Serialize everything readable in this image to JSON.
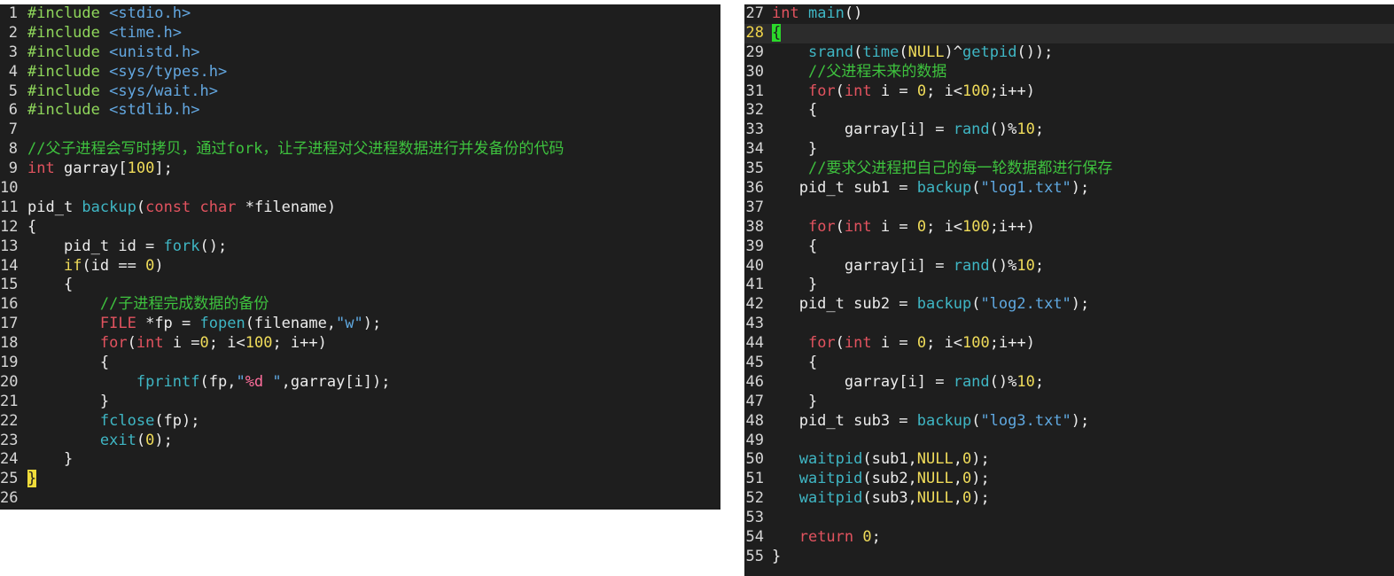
{
  "left_pane": {
    "lines": [
      {
        "n": "1",
        "tokens": [
          [
            "pre",
            "#include "
          ],
          [
            "inc",
            "<stdio.h>"
          ]
        ]
      },
      {
        "n": "2",
        "tokens": [
          [
            "pre",
            "#include "
          ],
          [
            "inc",
            "<time.h>"
          ]
        ]
      },
      {
        "n": "3",
        "tokens": [
          [
            "pre",
            "#include "
          ],
          [
            "inc",
            "<unistd.h>"
          ]
        ]
      },
      {
        "n": "4",
        "tokens": [
          [
            "pre",
            "#include "
          ],
          [
            "inc",
            "<sys/types.h>"
          ]
        ]
      },
      {
        "n": "5",
        "tokens": [
          [
            "pre",
            "#include "
          ],
          [
            "inc",
            "<sys/wait.h>"
          ]
        ]
      },
      {
        "n": "6",
        "tokens": [
          [
            "pre",
            "#include "
          ],
          [
            "inc",
            "<stdlib.h>"
          ]
        ]
      },
      {
        "n": "7",
        "tokens": []
      },
      {
        "n": "8",
        "tokens": [
          [
            "cmt",
            "//父子进程会写时拷贝，通过fork，让子进程对父进程数据进行并发备份的代码"
          ]
        ]
      },
      {
        "n": "9",
        "tokens": [
          [
            "kw",
            "int"
          ],
          [
            "txt",
            " garray["
          ],
          [
            "num",
            "100"
          ],
          [
            "txt",
            "];"
          ]
        ]
      },
      {
        "n": "10",
        "tokens": []
      },
      {
        "n": "11",
        "tokens": [
          [
            "txt",
            "pid_t "
          ],
          [
            "fn",
            "backup"
          ],
          [
            "txt",
            "("
          ],
          [
            "kw",
            "const"
          ],
          [
            "txt",
            " "
          ],
          [
            "kw",
            "char"
          ],
          [
            "txt",
            " *filename)"
          ]
        ]
      },
      {
        "n": "12",
        "tokens": [
          [
            "txt",
            "{"
          ]
        ]
      },
      {
        "n": "13",
        "tokens": [
          [
            "txt",
            "    pid_t id = "
          ],
          [
            "fn",
            "fork"
          ],
          [
            "txt",
            "();"
          ]
        ]
      },
      {
        "n": "14",
        "tokens": [
          [
            "txt",
            "    "
          ],
          [
            "num",
            "if"
          ],
          [
            "txt",
            "(id == "
          ],
          [
            "num",
            "0"
          ],
          [
            "txt",
            ")"
          ]
        ]
      },
      {
        "n": "15",
        "tokens": [
          [
            "txt",
            "    {"
          ]
        ]
      },
      {
        "n": "16",
        "tokens": [
          [
            "txt",
            "        "
          ],
          [
            "cmt",
            "//子进程完成数据的备份"
          ]
        ]
      },
      {
        "n": "17",
        "tokens": [
          [
            "txt",
            "        "
          ],
          [
            "kw",
            "FILE"
          ],
          [
            "txt",
            " *fp = "
          ],
          [
            "fn",
            "fopen"
          ],
          [
            "txt",
            "(filename,"
          ],
          [
            "str",
            "\"w\""
          ],
          [
            "txt",
            ");"
          ]
        ]
      },
      {
        "n": "18",
        "tokens": [
          [
            "txt",
            "        "
          ],
          [
            "kw",
            "for"
          ],
          [
            "txt",
            "("
          ],
          [
            "kw",
            "int"
          ],
          [
            "txt",
            " i ="
          ],
          [
            "num",
            "0"
          ],
          [
            "txt",
            "; i<"
          ],
          [
            "num",
            "100"
          ],
          [
            "txt",
            "; i++)"
          ]
        ]
      },
      {
        "n": "19",
        "tokens": [
          [
            "txt",
            "        {"
          ]
        ]
      },
      {
        "n": "20",
        "tokens": [
          [
            "txt",
            "            "
          ],
          [
            "fn",
            "fprintf"
          ],
          [
            "txt",
            "(fp,"
          ],
          [
            "str",
            "\""
          ],
          [
            "fmt",
            "%d "
          ],
          [
            "str",
            "\""
          ],
          [
            "txt",
            ",garray[i]);"
          ]
        ]
      },
      {
        "n": "21",
        "tokens": [
          [
            "txt",
            "        }"
          ]
        ]
      },
      {
        "n": "22",
        "tokens": [
          [
            "txt",
            "        "
          ],
          [
            "fn",
            "fclose"
          ],
          [
            "txt",
            "(fp);"
          ]
        ]
      },
      {
        "n": "23",
        "tokens": [
          [
            "txt",
            "        "
          ],
          [
            "fn",
            "exit"
          ],
          [
            "txt",
            "("
          ],
          [
            "num",
            "0"
          ],
          [
            "txt",
            ");"
          ]
        ]
      },
      {
        "n": "24",
        "tokens": [
          [
            "txt",
            "    }"
          ]
        ]
      },
      {
        "n": "25",
        "tokens": [
          [
            "brace-yellow",
            "}"
          ]
        ]
      },
      {
        "n": "26",
        "tokens": []
      }
    ]
  },
  "right_pane": {
    "lines": [
      {
        "n": "27",
        "tokens": [
          [
            "kw",
            "int"
          ],
          [
            "txt",
            " "
          ],
          [
            "fn",
            "main"
          ],
          [
            "txt",
            "()"
          ]
        ]
      },
      {
        "n": "28",
        "current": true,
        "tokens": [
          [
            "brace-green",
            "{"
          ]
        ]
      },
      {
        "n": "29",
        "tokens": [
          [
            "txt",
            "    "
          ],
          [
            "fn",
            "srand"
          ],
          [
            "txt",
            "("
          ],
          [
            "fn",
            "time"
          ],
          [
            "txt",
            "("
          ],
          [
            "null",
            "NULL"
          ],
          [
            "txt",
            ")^"
          ],
          [
            "fn",
            "getpid"
          ],
          [
            "txt",
            "());"
          ]
        ]
      },
      {
        "n": "30",
        "tokens": [
          [
            "txt",
            "    "
          ],
          [
            "cmt",
            "//父进程未来的数据"
          ]
        ]
      },
      {
        "n": "31",
        "tokens": [
          [
            "txt",
            "    "
          ],
          [
            "kw",
            "for"
          ],
          [
            "txt",
            "("
          ],
          [
            "kw",
            "int"
          ],
          [
            "txt",
            " i = "
          ],
          [
            "num",
            "0"
          ],
          [
            "txt",
            "; i<"
          ],
          [
            "num",
            "100"
          ],
          [
            "txt",
            ";i++)"
          ]
        ]
      },
      {
        "n": "32",
        "tokens": [
          [
            "txt",
            "    {"
          ]
        ]
      },
      {
        "n": "33",
        "tokens": [
          [
            "txt",
            "        garray[i] = "
          ],
          [
            "fn",
            "rand"
          ],
          [
            "txt",
            "()%"
          ],
          [
            "num",
            "10"
          ],
          [
            "txt",
            ";"
          ]
        ]
      },
      {
        "n": "34",
        "tokens": [
          [
            "txt",
            "    }"
          ]
        ]
      },
      {
        "n": "35",
        "tokens": [
          [
            "txt",
            "    "
          ],
          [
            "cmt",
            "//要求父进程把自己的每一轮数据都进行保存"
          ]
        ]
      },
      {
        "n": "36",
        "tokens": [
          [
            "txt",
            "   pid_t sub1 = "
          ],
          [
            "fn",
            "backup"
          ],
          [
            "txt",
            "("
          ],
          [
            "str",
            "\"log1.txt\""
          ],
          [
            "txt",
            ");"
          ]
        ]
      },
      {
        "n": "37",
        "tokens": []
      },
      {
        "n": "38",
        "tokens": [
          [
            "txt",
            "    "
          ],
          [
            "kw",
            "for"
          ],
          [
            "txt",
            "("
          ],
          [
            "kw",
            "int"
          ],
          [
            "txt",
            " i = "
          ],
          [
            "num",
            "0"
          ],
          [
            "txt",
            "; i<"
          ],
          [
            "num",
            "100"
          ],
          [
            "txt",
            ";i++)"
          ]
        ]
      },
      {
        "n": "39",
        "tokens": [
          [
            "txt",
            "    {"
          ]
        ]
      },
      {
        "n": "40",
        "tokens": [
          [
            "txt",
            "        garray[i] = "
          ],
          [
            "fn",
            "rand"
          ],
          [
            "txt",
            "()%"
          ],
          [
            "num",
            "10"
          ],
          [
            "txt",
            ";"
          ]
        ]
      },
      {
        "n": "41",
        "tokens": [
          [
            "txt",
            "    }"
          ]
        ]
      },
      {
        "n": "42",
        "tokens": [
          [
            "txt",
            "   pid_t sub2 = "
          ],
          [
            "fn",
            "backup"
          ],
          [
            "txt",
            "("
          ],
          [
            "str",
            "\"log2.txt\""
          ],
          [
            "txt",
            ");"
          ]
        ]
      },
      {
        "n": "43",
        "tokens": []
      },
      {
        "n": "44",
        "tokens": [
          [
            "txt",
            "    "
          ],
          [
            "kw",
            "for"
          ],
          [
            "txt",
            "("
          ],
          [
            "kw",
            "int"
          ],
          [
            "txt",
            " i = "
          ],
          [
            "num",
            "0"
          ],
          [
            "txt",
            "; i<"
          ],
          [
            "num",
            "100"
          ],
          [
            "txt",
            ";i++)"
          ]
        ]
      },
      {
        "n": "45",
        "tokens": [
          [
            "txt",
            "    {"
          ]
        ]
      },
      {
        "n": "46",
        "tokens": [
          [
            "txt",
            "        garray[i] = "
          ],
          [
            "fn",
            "rand"
          ],
          [
            "txt",
            "()%"
          ],
          [
            "num",
            "10"
          ],
          [
            "txt",
            ";"
          ]
        ]
      },
      {
        "n": "47",
        "tokens": [
          [
            "txt",
            "    }"
          ]
        ]
      },
      {
        "n": "48",
        "tokens": [
          [
            "txt",
            "   pid_t sub3 = "
          ],
          [
            "fn",
            "backup"
          ],
          [
            "txt",
            "("
          ],
          [
            "str",
            "\"log3.txt\""
          ],
          [
            "txt",
            ");"
          ]
        ]
      },
      {
        "n": "49",
        "tokens": []
      },
      {
        "n": "50",
        "tokens": [
          [
            "txt",
            "   "
          ],
          [
            "fn",
            "waitpid"
          ],
          [
            "txt",
            "(sub1,"
          ],
          [
            "null",
            "NULL"
          ],
          [
            "txt",
            ","
          ],
          [
            "num",
            "0"
          ],
          [
            "txt",
            ");"
          ]
        ]
      },
      {
        "n": "51",
        "tokens": [
          [
            "txt",
            "   "
          ],
          [
            "fn",
            "waitpid"
          ],
          [
            "txt",
            "(sub2,"
          ],
          [
            "null",
            "NULL"
          ],
          [
            "txt",
            ","
          ],
          [
            "num",
            "0"
          ],
          [
            "txt",
            ");"
          ]
        ]
      },
      {
        "n": "52",
        "tokens": [
          [
            "txt",
            "   "
          ],
          [
            "fn",
            "waitpid"
          ],
          [
            "txt",
            "(sub3,"
          ],
          [
            "null",
            "NULL"
          ],
          [
            "txt",
            ","
          ],
          [
            "num",
            "0"
          ],
          [
            "txt",
            ");"
          ]
        ]
      },
      {
        "n": "53",
        "tokens": []
      },
      {
        "n": "54",
        "tokens": [
          [
            "txt",
            "   "
          ],
          [
            "kw",
            "return"
          ],
          [
            "txt",
            " "
          ],
          [
            "num",
            "0"
          ],
          [
            "txt",
            ";"
          ]
        ]
      },
      {
        "n": "55",
        "tokens": [
          [
            "txt",
            "}"
          ]
        ]
      }
    ]
  }
}
